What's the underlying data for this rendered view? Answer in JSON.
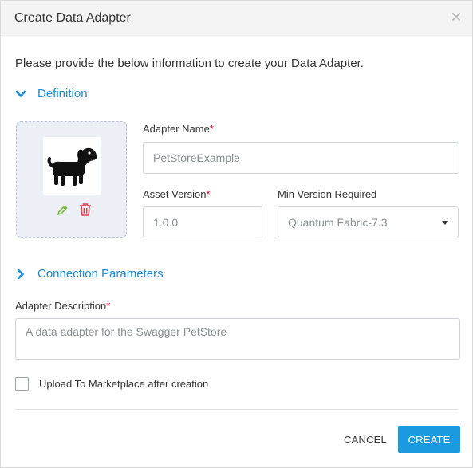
{
  "dialog": {
    "title": "Create Data Adapter",
    "close_icon": "close-icon"
  },
  "intro_text": "Please provide the below information to create your Data Adapter.",
  "sections": {
    "definition": {
      "label": "Definition",
      "expanded": true
    },
    "connection": {
      "label": "Connection Parameters",
      "expanded": false
    }
  },
  "image": {
    "icon": "dog-icon",
    "edit_icon": "pencil-icon",
    "delete_icon": "trash-icon"
  },
  "fields": {
    "adapter_name": {
      "label": "Adapter Name",
      "required": "*",
      "value": "PetStoreExample"
    },
    "asset_version": {
      "label": "Asset Version",
      "required": "*",
      "value": "1.0.0"
    },
    "min_version": {
      "label": "Min Version Required",
      "value": "Quantum Fabric-7.3"
    },
    "description": {
      "label": "Adapter Description",
      "required": "*",
      "value": "A data adapter for the Swagger PetStore"
    }
  },
  "upload_checkbox": {
    "label": "Upload To Marketplace after creation",
    "checked": false
  },
  "buttons": {
    "cancel": "CANCEL",
    "create": "CREATE"
  },
  "colors": {
    "accent": "#1b9ae0",
    "link": "#1a8ccf",
    "required": "#d0021b",
    "edit_icon": "#7dbb3c",
    "delete_icon": "#e0434b"
  }
}
